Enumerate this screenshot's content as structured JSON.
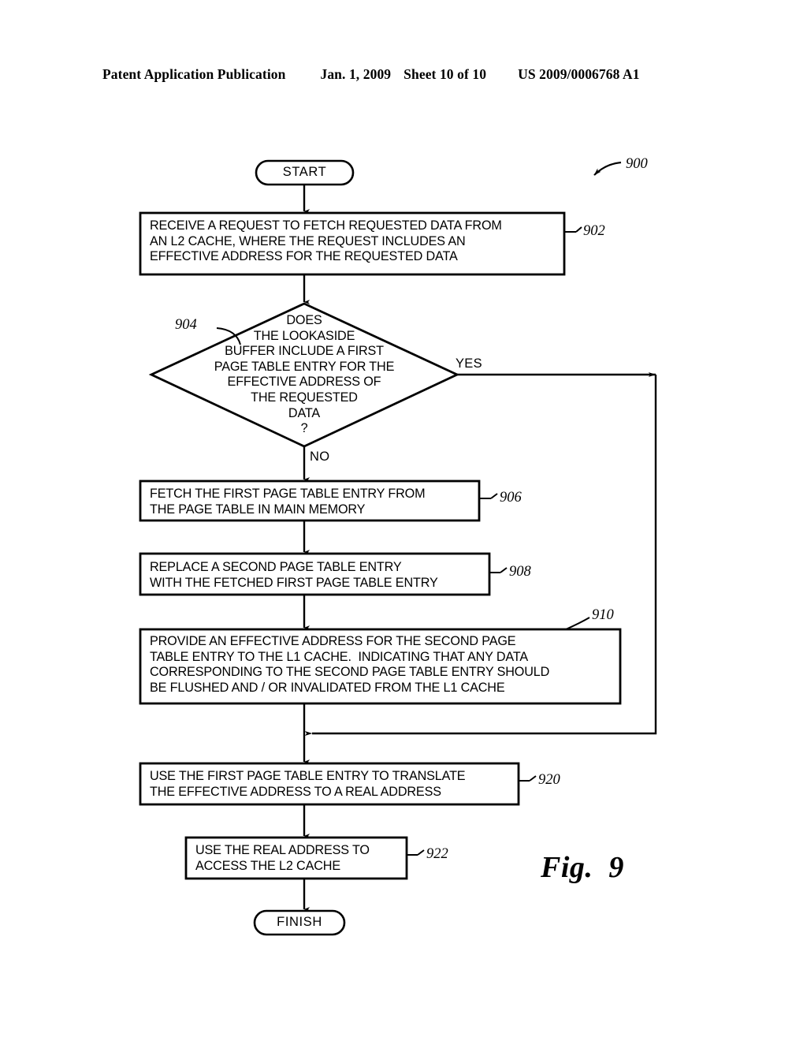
{
  "header": {
    "publication": "Patent Application Publication",
    "date": "Jan. 1, 2009",
    "sheet": "Sheet 10 of 10",
    "patent_number": "US 2009/0006768 A1"
  },
  "figure": {
    "caption": "Fig.  9",
    "diagram_ref": "900"
  },
  "flowchart": {
    "start": {
      "label": "START"
    },
    "finish": {
      "label": "FINISH"
    },
    "steps": [
      {
        "ref": "902",
        "shape": "process",
        "lines": [
          "RECEIVE A REQUEST TO FETCH REQUESTED DATA FROM",
          "AN L2 CACHE, WHERE THE REQUEST INCLUDES AN",
          "EFFECTIVE ADDRESS FOR THE REQUESTED DATA"
        ]
      },
      {
        "ref": "904",
        "shape": "decision",
        "lines": [
          "DOES",
          "THE LOOKASIDE",
          "BUFFER INCLUDE A FIRST",
          "PAGE TABLE ENTRY FOR THE",
          "EFFECTIVE ADDRESS OF",
          "THE REQUESTED",
          "DATA",
          "?"
        ]
      },
      {
        "ref": "906",
        "shape": "process",
        "lines": [
          "FETCH THE FIRST PAGE TABLE ENTRY FROM",
          "THE PAGE TABLE IN MAIN MEMORY"
        ]
      },
      {
        "ref": "908",
        "shape": "process",
        "lines": [
          "REPLACE A SECOND PAGE TABLE ENTRY",
          "WITH THE FETCHED FIRST PAGE TABLE ENTRY"
        ]
      },
      {
        "ref": "910",
        "shape": "process",
        "lines": [
          "PROVIDE AN EFFECTIVE ADDRESS FOR THE SECOND PAGE",
          "TABLE ENTRY TO THE L1 CACHE.  INDICATING THAT ANY DATA",
          "CORRESPONDING TO THE SECOND PAGE TABLE ENTRY SHOULD",
          "BE FLUSHED AND / OR INVALIDATED FROM THE L1 CACHE"
        ]
      },
      {
        "ref": "920",
        "shape": "process",
        "lines": [
          "USE THE FIRST PAGE TABLE ENTRY TO TRANSLATE",
          "THE EFFECTIVE ADDRESS TO A REAL ADDRESS"
        ]
      },
      {
        "ref": "922",
        "shape": "process",
        "lines": [
          "USE THE REAL ADDRESS TO",
          "ACCESS THE L2 CACHE"
        ]
      }
    ],
    "branch_labels": {
      "yes": "YES",
      "no": "NO"
    }
  },
  "colors": {
    "ink": "#000000",
    "paper": "#ffffff"
  }
}
